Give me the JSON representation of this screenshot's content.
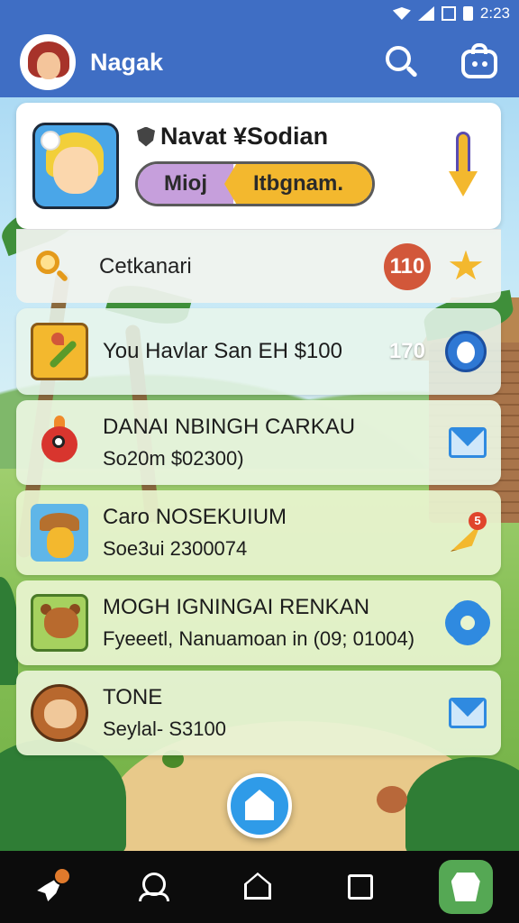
{
  "status_bar": {
    "time": "2:23"
  },
  "app_bar": {
    "title": "Nagak"
  },
  "profile": {
    "name": "Navat ¥Sodian",
    "pill_left": "Mioj",
    "pill_right": "Itbgnam."
  },
  "search_row": {
    "label": "Cetkanari",
    "count": "110"
  },
  "list": [
    {
      "title": "You Havlar San EH $100",
      "number": "170",
      "icon": "mascot-icon"
    },
    {
      "title": "DANAI NBINGH CARKAU",
      "subtitle": "So20m  $02300)",
      "icon": "mail-icon"
    },
    {
      "title": "Caro NOSEKUIUM",
      "subtitle": "Soe3ui  2300074",
      "icon": "notification-cone-icon",
      "badge": "5"
    },
    {
      "title": "MOGH IGNINGAI RENKAN",
      "subtitle": "Fyeeetl, Nanuamoan in (09; 01004)",
      "icon": "gear-icon"
    },
    {
      "title": "TONE",
      "subtitle": "Seylal-  S3100",
      "icon": "mail-icon"
    }
  ],
  "colors": {
    "appbar": "#3f6ec4",
    "badge": "#d2573a",
    "accent_yellow": "#f3b82e",
    "pill_purple": "#c69fdc",
    "nav_active": "#55a854"
  }
}
